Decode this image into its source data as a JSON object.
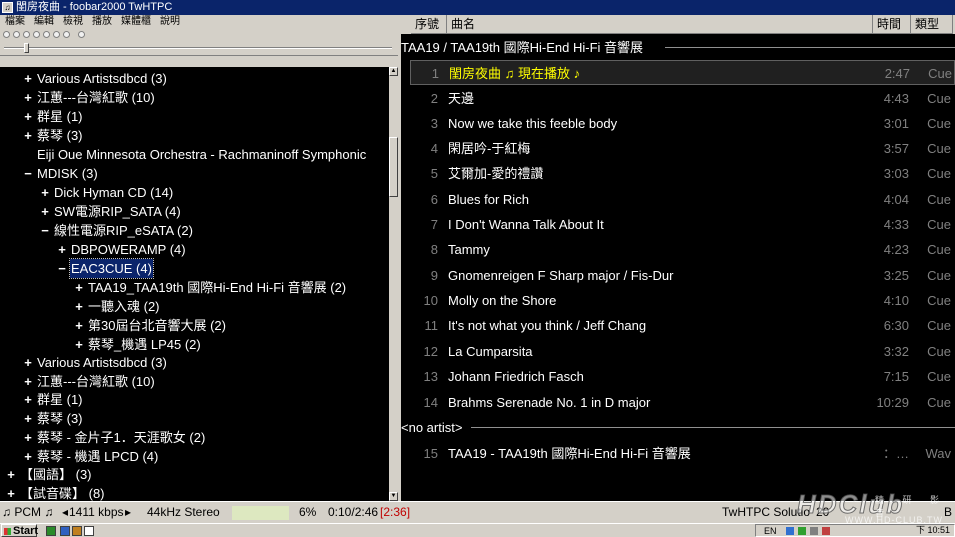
{
  "window": {
    "title": "閨房夜曲 - foobar2000 TwHTPC"
  },
  "menu": [
    "檔案",
    "編輯",
    "檢視",
    "播放",
    "媒體櫃",
    "說明"
  ],
  "playlist_columns": {
    "index": "序號",
    "title": "曲名",
    "time": "時間",
    "type": "類型"
  },
  "tree": [
    {
      "exp": "+",
      "label": "Various Artistsdbcd (3)"
    },
    {
      "exp": "+",
      "label": "江蕙---台灣紅歌 (10)"
    },
    {
      "exp": "+",
      "label": "群星 (1)"
    },
    {
      "exp": "+",
      "label": "蔡琴 (3)"
    },
    {
      "exp": "",
      "label": "Eiji Oue  Minnesota Orchestra - Rachmaninoff  Symphonic"
    },
    {
      "exp": "−",
      "label": "MDISK (3)"
    },
    {
      "exp": "+",
      "label": "Dick Hyman CD (14)"
    },
    {
      "exp": "+",
      "label": "SW電源RIP_SATA (4)"
    },
    {
      "exp": "−",
      "label": "線性電源RIP_eSATA (2)"
    },
    {
      "exp": "+",
      "label": "DBPOWERAMP (4)"
    },
    {
      "exp": "−",
      "label": "EAC3CUE (4)"
    },
    {
      "exp": "+",
      "label": "TAA19_TAA19th 國際Hi-End Hi-Fi 音響展 (2)"
    },
    {
      "exp": "+",
      "label": "一聽入魂 (2)"
    },
    {
      "exp": "+",
      "label": "第30屆台北音響大展 (2)"
    },
    {
      "exp": "+",
      "label": "蔡琴_機遇 LP45 (2)"
    },
    {
      "exp": "+",
      "label": "Various Artistsdbcd (3)"
    },
    {
      "exp": "+",
      "label": "江蕙---台灣紅歌 (10)"
    },
    {
      "exp": "+",
      "label": "群星 (1)"
    },
    {
      "exp": "+",
      "label": "蔡琴 (3)"
    },
    {
      "exp": "+",
      "label": "蔡琴 - 金片子1．天涯歌女 (2)"
    },
    {
      "exp": "+",
      "label": "蔡琴 - 機遇 LPCD (4)"
    },
    {
      "exp": "+",
      "label": "【國語】 (3)"
    },
    {
      "exp": "+",
      "label": "【試音碟】 (8)"
    }
  ],
  "playlist": {
    "group1": "TAA19 / TAA19th 國際Hi-End Hi-Fi 音響展",
    "group2": "<no artist>",
    "tracks": [
      {
        "num": "1",
        "title": "閨房夜曲 ♫ 現在播放 ♪",
        "time": "2:47",
        "type": "Cue"
      },
      {
        "num": "2",
        "title": "天邊",
        "time": "4:43",
        "type": "Cue"
      },
      {
        "num": "3",
        "title": "Now we take this feeble body",
        "time": "3:01",
        "type": "Cue"
      },
      {
        "num": "4",
        "title": "閑居吟-于紅梅",
        "time": "3:57",
        "type": "Cue"
      },
      {
        "num": "5",
        "title": "艾爾加-愛的禮讚",
        "time": "3:03",
        "type": "Cue"
      },
      {
        "num": "6",
        "title": "Blues for Rich",
        "time": "4:04",
        "type": "Cue"
      },
      {
        "num": "7",
        "title": "I Don't Wanna Talk About It",
        "time": "4:33",
        "type": "Cue"
      },
      {
        "num": "8",
        "title": "Tammy",
        "time": "4:23",
        "type": "Cue"
      },
      {
        "num": "9",
        "title": "Gnomenreigen F Sharp major / Fis-Dur",
        "time": "3:25",
        "type": "Cue"
      },
      {
        "num": "10",
        "title": "Molly on the Shore",
        "time": "4:10",
        "type": "Cue"
      },
      {
        "num": "11",
        "title": "It's not what you think / Jeff Chang",
        "time": "6:30",
        "type": "Cue"
      },
      {
        "num": "12",
        "title": "La Cumparsita",
        "time": "3:32",
        "type": "Cue"
      },
      {
        "num": "13",
        "title": "Johann Friedrich Fasch",
        "time": "7:15",
        "type": "Cue"
      },
      {
        "num": "14",
        "title": "Brahms Serenade No. 1 in D major",
        "time": "10:29",
        "type": "Cue"
      }
    ],
    "extra_track": {
      "num": "15",
      "title": "TAA19 - TAA19th 國際Hi-End Hi-Fi 音響展",
      "time": "：…",
      "type": "Wav"
    }
  },
  "status": {
    "codec": "♫ PCM ♫",
    "bitrate": "1411 kbps",
    "samplerate": "44kHz  Stereo",
    "buffer": "6%",
    "position": "0:10/2:46",
    "remaining": "[2:36]",
    "brand": "TwHTPC Solutio",
    "brand_tail": "20",
    "size": "B"
  },
  "taskbar": {
    "start": "Start",
    "lang": "EN",
    "clock": "下 10:51"
  },
  "watermark": {
    "main": "HDClub",
    "cn": "精 研 影 音",
    "url": "WWW.HD-CLUB.TW"
  }
}
